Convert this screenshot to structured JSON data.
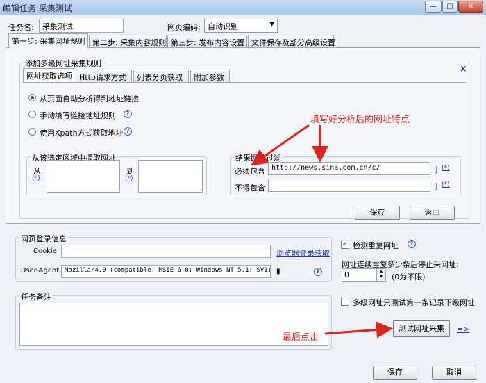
{
  "window": {
    "title": "编辑任务 采集测试",
    "minimize": "—",
    "maximize": "▢",
    "close": "✕"
  },
  "header": {
    "task_name_label": "任务名:",
    "task_name_value": "采集测试",
    "encoding_label": "网页编码:",
    "encoding_value": "自动识别"
  },
  "tabs": [
    {
      "label": "第一步: 采集网址规则"
    },
    {
      "label": "第二步: 采集内容规则"
    },
    {
      "label": "第三步: 发布内容设置"
    },
    {
      "label": "文件保存及部分高级设置"
    }
  ],
  "rule_panel": {
    "title": "添加多级网址采集规则",
    "close_icon": "×",
    "subtabs": [
      {
        "label": "网址获取选项"
      },
      {
        "label": "Http请求方式"
      },
      {
        "label": "列表分页获取"
      },
      {
        "label": "附加参数"
      }
    ],
    "radios": [
      {
        "label": "从页面自动分析得到地址链接",
        "checked": true
      },
      {
        "label": "手动填写链接地址规则",
        "checked": false
      },
      {
        "label": "使用Xpath方式获取地址",
        "checked": false
      }
    ],
    "extract_group": {
      "title": "从该选定区域中提取网址",
      "from_label": "从",
      "to_label": "到",
      "from_wildcard": "(*)",
      "to_wildcard": "(*)",
      "from_value": "",
      "to_value": ""
    },
    "filter_group": {
      "title": "结果网址过滤",
      "must_contain_label": "必须包含",
      "must_contain_value": "http://news.sina.com.cn/c/",
      "not_contain_label": "不得包含",
      "not_contain_value": "",
      "or_link": "|",
      "wildcard_link": "(*)"
    },
    "save_button": "保存",
    "back_button": "返回"
  },
  "login": {
    "title": "网页登录信息",
    "cookie_label": "Cookie",
    "cookie_value": "",
    "browser_login_link": "浏览器登录获取",
    "ua_label": "User-Agent",
    "ua_value": "Mozilla/4.0 (compatible; MSIE 6.0; Windows NT 5.1; SV1; ."
  },
  "options": {
    "detect_duplicate_label": "检测重复网址",
    "detect_duplicate_checked": true,
    "stop_label": "网址连续重复多少条后停止采网址:",
    "stop_value": "0",
    "stop_hint": "(0为不限)",
    "multi_level_label": "多级网址只测试第一条记录下级网址",
    "multi_level_checked": false
  },
  "notes": {
    "title": "任务备注",
    "value": ""
  },
  "test_button": "测试网址采集",
  "arrow_link": "=>",
  "footer": {
    "save_button": "保存",
    "cancel_button": "取消"
  },
  "annotations": {
    "top_note": "填写好分析后的网址特点",
    "bottom_note": "最后点击",
    "color": "#e0231a"
  },
  "colors": {
    "accent_link": "#1f37c9",
    "window_bg": "#eef2f7"
  }
}
